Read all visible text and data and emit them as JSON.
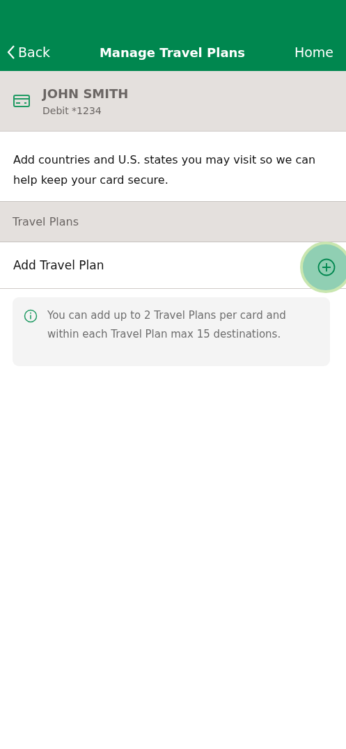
{
  "nav": {
    "back": "Back",
    "title": "Manage Travel Plans",
    "home": "Home"
  },
  "card": {
    "name": "JOHN SMITH",
    "account": "Debit *1234"
  },
  "description": "Add countries and U.S. states you may visit so we can help keep your card secure.",
  "section": {
    "title": "Travel Plans"
  },
  "add_row": {
    "label": "Add Travel Plan",
    "pressed": true
  },
  "info": {
    "text": "You can add up to 2 Travel Plans per card and within each Travel Plan max 15 destinations."
  }
}
